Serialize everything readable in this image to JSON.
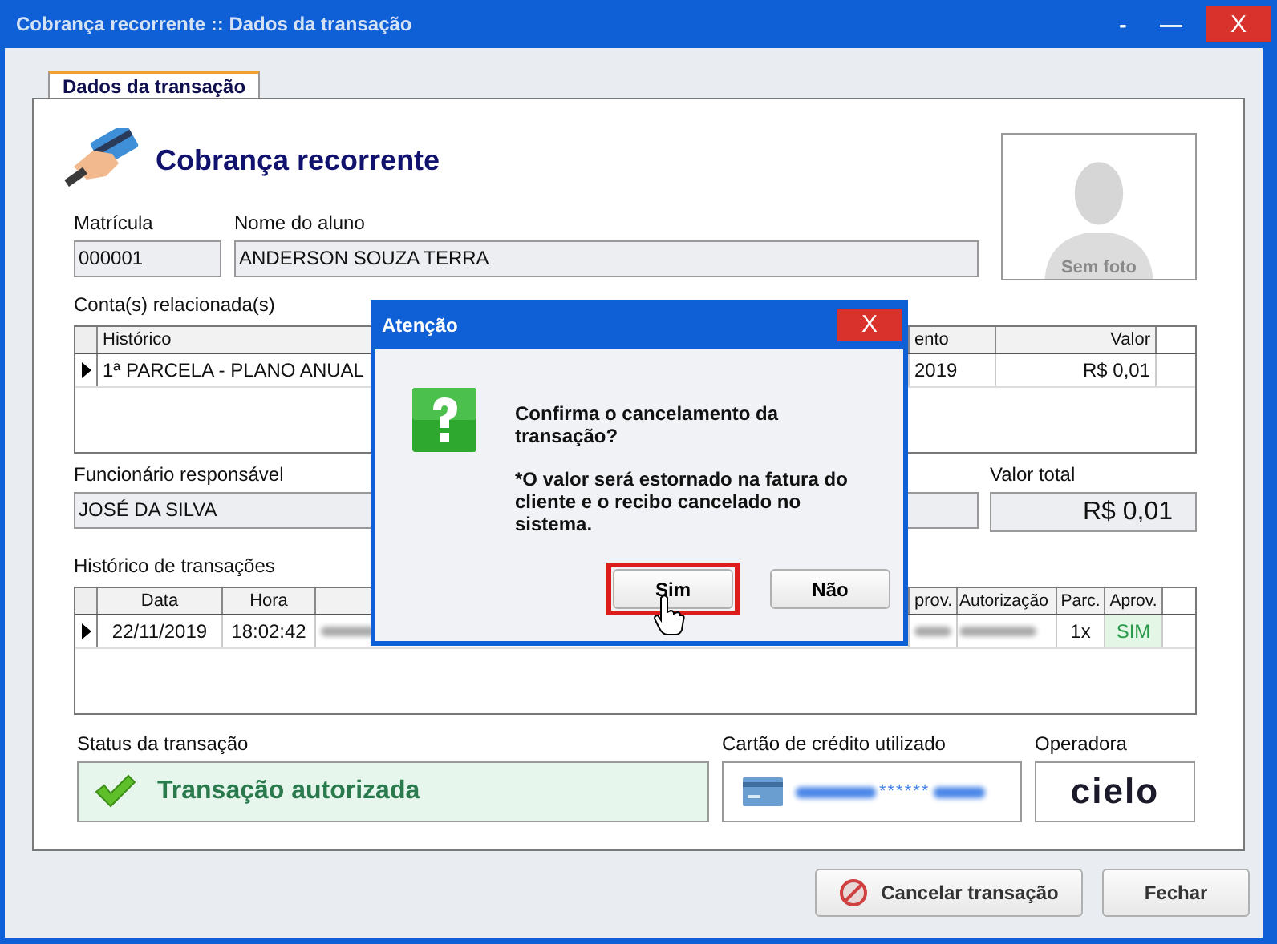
{
  "window": {
    "title": "Cobrança recorrente :: Dados da transação",
    "controls": [
      {
        "kind": "minimize",
        "glyph": "-"
      },
      {
        "kind": "maximize",
        "glyph": "—"
      },
      {
        "kind": "close",
        "glyph": "X"
      }
    ]
  },
  "tabs": [
    {
      "label": "Dados da transação",
      "selected": true
    }
  ],
  "header": {
    "title": "Cobrança recorrente"
  },
  "photo": {
    "caption": "Sem foto"
  },
  "enrollment": {
    "label": "Matrícula",
    "value": "000001"
  },
  "student": {
    "label": "Nome do aluno",
    "value": "ANDERSON SOUZA TERRA"
  },
  "accounts": {
    "label": "Conta(s) relacionada(s)",
    "columns": [
      "Histórico",
      "ento",
      "Valor"
    ],
    "rows": [
      {
        "selected": true,
        "cells": [
          "1ª PARCELA - PLANO ANUAL",
          "2019",
          "R$ 0,01"
        ]
      }
    ]
  },
  "employee": {
    "label": "Funcionário responsável",
    "value": "JOSÉ DA SILVA"
  },
  "total": {
    "label": "Valor total",
    "value": "R$ 0,01"
  },
  "transactions": {
    "label": "Histórico de transações",
    "columns": [
      {
        "kind": "label",
        "label": "Data"
      },
      {
        "kind": "label",
        "label": "Hora"
      },
      {
        "kind": "covered"
      },
      {
        "kind": "label",
        "label": "prov."
      },
      {
        "kind": "label",
        "label": "Autorização"
      },
      {
        "kind": "label",
        "label": "Parc."
      },
      {
        "kind": "label",
        "label": "Aprov."
      }
    ],
    "rows": [
      {
        "selected": true,
        "cells": [
          {
            "kind": "text",
            "text": "22/11/2019"
          },
          {
            "kind": "text",
            "text": "18:02:42"
          },
          {
            "kind": "redacted"
          },
          {
            "kind": "redacted"
          },
          {
            "kind": "redacted"
          },
          {
            "kind": "text",
            "text": "1x"
          },
          {
            "kind": "positive",
            "text": "SIM"
          }
        ]
      }
    ]
  },
  "status": {
    "label": "Status da transação",
    "text": "Transação autorizada",
    "authorized": true
  },
  "card": {
    "label": "Cartão de crédito utilizado",
    "masked": "******"
  },
  "operator": {
    "label": "Operadora",
    "logo": "cielo"
  },
  "buttons": [
    {
      "kind": "cancel",
      "label": "Cancelar transação"
    },
    {
      "kind": "plain",
      "label": "Fechar"
    }
  ],
  "dialog": {
    "title": "Atenção",
    "close": "X",
    "message": "Confirma o cancelamento da transação?",
    "note": "*O valor será estornado na fatura do cliente e o recibo cancelado no sistema.",
    "buttons": [
      {
        "label": "Sim",
        "focused": true
      },
      {
        "label": "Não",
        "focused": false
      }
    ]
  }
}
